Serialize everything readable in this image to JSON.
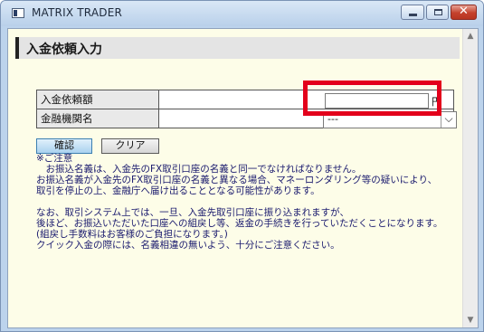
{
  "window": {
    "title": "MATRIX TRADER",
    "close_glyph": "✕"
  },
  "page": {
    "title": "入金依頼入力"
  },
  "form": {
    "amount_label": "入金依頼額",
    "amount_value": "",
    "amount_unit": "円",
    "bank_label": "金融機関名",
    "bank_selected": "---"
  },
  "buttons": {
    "confirm": "確認",
    "clear": "クリア"
  },
  "notes": {
    "heading": "※ご注意",
    "lines": [
      "　お振込名義は、入金先のFX取引口座の名義と同一でなければなりません。",
      "お振込名義が入金先のFX取引口座の名義と異なる場合、マネーロンダリング等の疑いにより、",
      "取引を停止の上、金融庁へ届け出ることとなる可能性があります。",
      "なお、取引システム上では、一旦、入金先取引口座に振り込まれますが、",
      "後ほど、お振込いただいた口座への組戻し等、返金の手続きを行っていただくことになります。",
      "(組戻し手数料はお客様のご負担になります。)",
      "クイック入金の際には、名義相違の無いよう、十分にご注意ください。"
    ]
  },
  "colors": {
    "highlight": "#e3001b",
    "note_text": "#1a1a6e",
    "content_bg": "#fdfde8"
  }
}
